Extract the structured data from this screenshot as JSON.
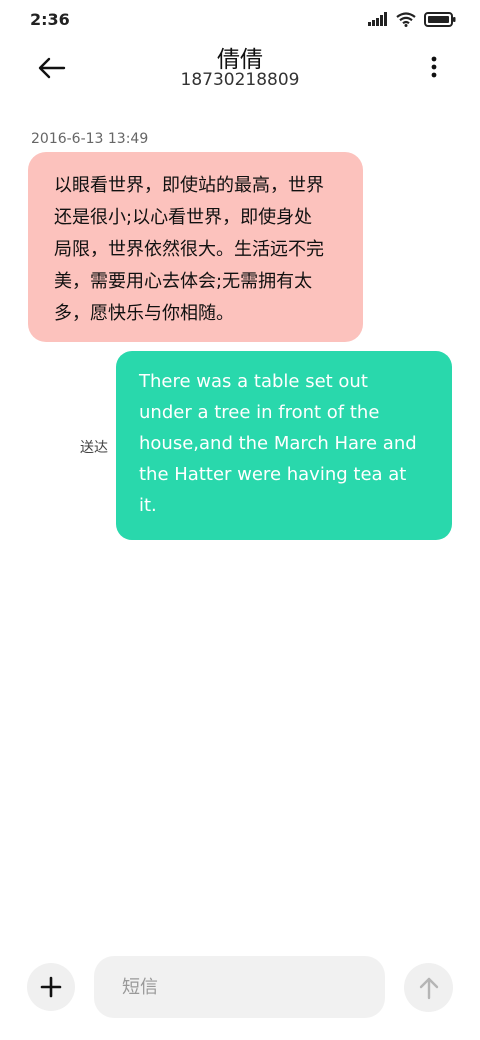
{
  "status_bar": {
    "time": "2:36",
    "icons": [
      "signal-icon",
      "wifi-icon",
      "battery-icon"
    ]
  },
  "header": {
    "contact_name": "倩倩",
    "contact_number": "18730218809",
    "back_icon": "back-arrow-icon",
    "more_icon": "more-vertical-icon"
  },
  "messages": {
    "timestamp": "2016-6-13 13:49",
    "incoming": {
      "lines": [
        "以眼看世界，即使站的最高，世界",
        "还是很小;以心看世界，即使身处",
        "局限，世界依然很大。生活远不完",
        "美，需要用心去体会;无需拥有太",
        "多，愿快乐与你相随。"
      ]
    },
    "outgoing": {
      "status": "送达",
      "lines": [
        "There was a table set out",
        "under a tree in front of the",
        "house,and the March Hare and",
        "the Hatter were having tea at",
        "it."
      ]
    }
  },
  "composer": {
    "placeholder": "短信",
    "add_icon": "plus-icon",
    "send_icon": "arrow-up-icon"
  },
  "colors": {
    "incoming_bubble": "#fcc2bd",
    "outgoing_bubble": "#29d8ac",
    "background": "#ffffff",
    "input_background": "#f1f1f1"
  }
}
